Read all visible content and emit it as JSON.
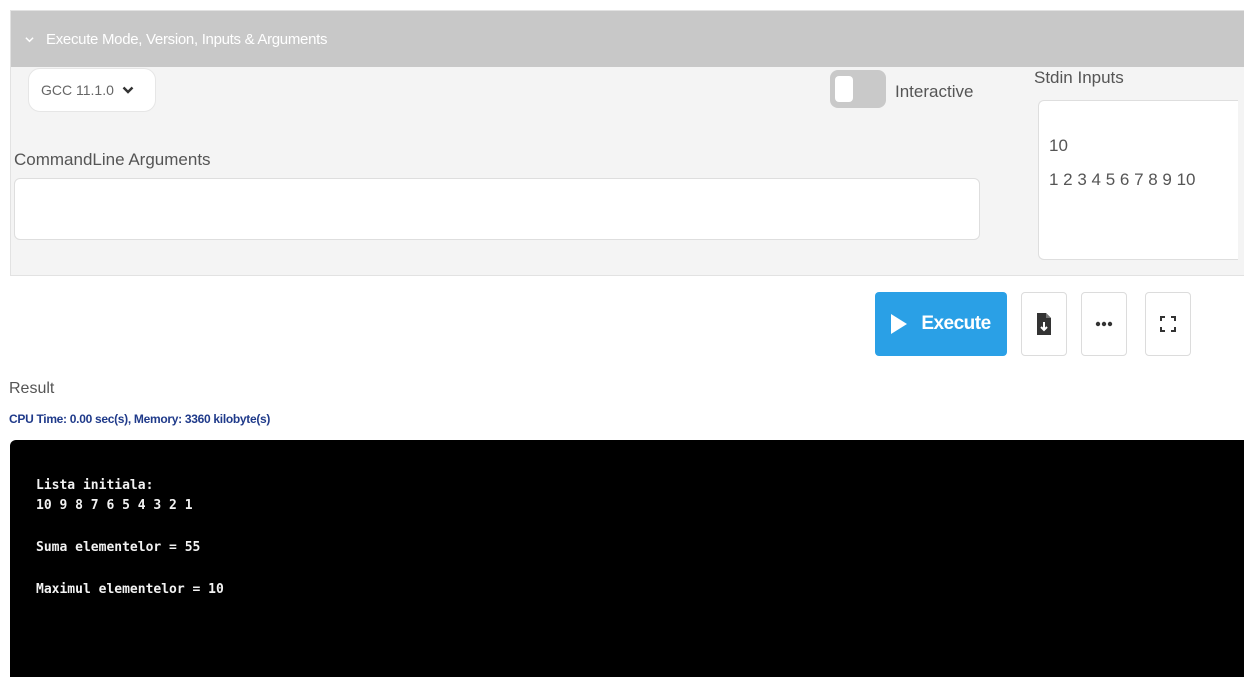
{
  "panel": {
    "header_title": "Execute Mode, Version, Inputs & Arguments",
    "version_selected": "GCC 11.1.0",
    "interactive_label": "Interactive",
    "interactive_on": false,
    "cmd_args_label": "CommandLine Arguments",
    "cmd_args_value": "",
    "stdin_label": "Stdin Inputs",
    "stdin_lines": [
      "10",
      "1 2 3 4 5 6 7 8 9 10"
    ]
  },
  "toolbar": {
    "execute_label": "Execute",
    "accent_color": "#2aa0e6"
  },
  "icons": {
    "download": "file-download-icon",
    "more": "more-options-icon",
    "fullscreen": "fullscreen-icon"
  },
  "result": {
    "label": "Result",
    "stats": "CPU Time: 0.00 sec(s), Memory: 3360 kilobyte(s)",
    "output": {
      "line1": "Lista initiala:",
      "line2": "10 9 8 7 6 5 4 3 2 1",
      "line3": "Suma elementelor = 55",
      "line4": "Maximul elementelor = 10"
    }
  }
}
